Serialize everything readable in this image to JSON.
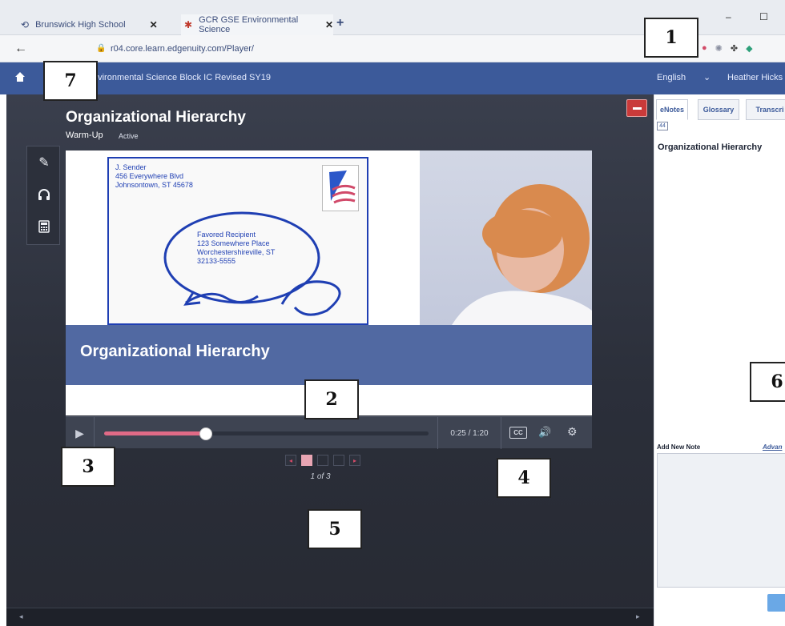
{
  "browser": {
    "tabs": [
      {
        "label": "Brunswick High School",
        "close": "✕"
      },
      {
        "label": "GCR GSE Environmental Science",
        "close": "✕"
      }
    ],
    "new_tab": "+",
    "window_controls": {
      "minimize": "–",
      "maximize": "☐"
    },
    "url": "r04.core.learn.edgenuity.com/Player/"
  },
  "app_header": {
    "course": "nvironmental Science Block IC Revised SY19",
    "language": "English",
    "language_chevron": "⌄",
    "user": "Heather Hicks"
  },
  "lesson": {
    "title": "Organizational Hierarchy",
    "activity": "Warm-Up",
    "status": "Active"
  },
  "video": {
    "envelope_sender": [
      "J. Sender",
      "456 Everywhere Blvd",
      "Johnsontown, ST 45678"
    ],
    "envelope_recipient": [
      "Favored Recipient",
      "123 Somewhere Place",
      "Worchestershireville, ST",
      "32133-5555"
    ],
    "slide_title": "Organizational Hierarchy"
  },
  "controls": {
    "play": "▶",
    "time": "0:25 / 1:20",
    "progress_fraction": 0.3125,
    "cc": "CC",
    "volume": "🔊",
    "settings": "⚙"
  },
  "pager": {
    "prev": "◂",
    "next": "▸",
    "current": 1,
    "total": 3,
    "count_text": "1 of 3"
  },
  "notes_panel": {
    "tabs": [
      "eNotes",
      "Glossary",
      "Transcri"
    ],
    "counter": "44",
    "heading": "Organizational Hierarchy",
    "add_note_label": "Add New Note",
    "advanced_link": "Advan"
  },
  "callouts": [
    "1",
    "2",
    "3",
    "4",
    "5",
    "6",
    "7"
  ],
  "colors": {
    "brand_header": "#3c5a9a",
    "progress": "#e06a86",
    "minimize_button": "#c93a3a",
    "player_background": "#2b2f3a"
  }
}
